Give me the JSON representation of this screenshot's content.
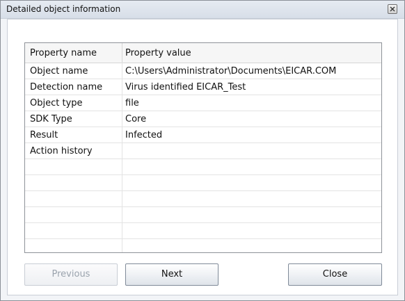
{
  "window": {
    "title": "Detailed object information"
  },
  "grid": {
    "columns": [
      "Property name",
      "Property value"
    ],
    "rows": [
      {
        "name": "Object name",
        "value": "C:\\Users\\Administrator\\Documents\\EICAR.COM"
      },
      {
        "name": "Detection name",
        "value": "Virus identified EICAR_Test"
      },
      {
        "name": "Object type",
        "value": "file"
      },
      {
        "name": "SDK Type",
        "value": "Core"
      },
      {
        "name": "Result",
        "value": "Infected"
      },
      {
        "name": "Action history",
        "value": ""
      },
      {
        "name": "",
        "value": ""
      },
      {
        "name": "",
        "value": ""
      },
      {
        "name": "",
        "value": ""
      },
      {
        "name": "",
        "value": ""
      },
      {
        "name": "",
        "value": ""
      },
      {
        "name": "",
        "value": ""
      }
    ]
  },
  "buttons": {
    "previous": "Previous",
    "next": "Next",
    "close": "Close"
  }
}
